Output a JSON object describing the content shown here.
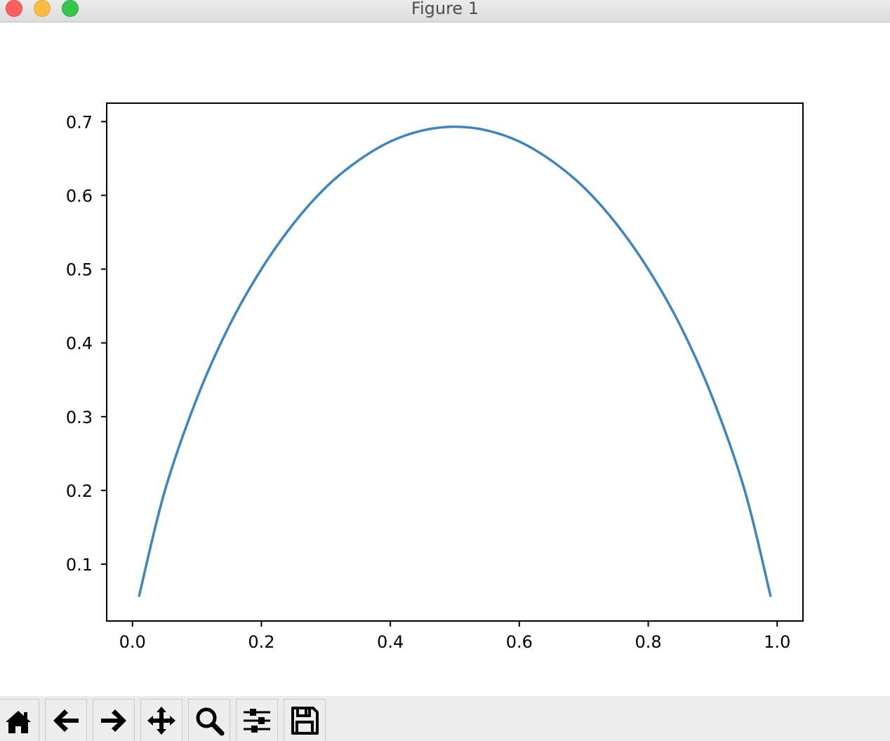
{
  "window": {
    "title": "Figure 1"
  },
  "colors": {
    "line": "#3d85bf",
    "axes": "#000000",
    "close": "#fc605b",
    "minimize": "#fdbc40",
    "maximize": "#34c84a"
  },
  "toolbar": {
    "buttons": [
      {
        "name": "home-button",
        "icon": "home-icon"
      },
      {
        "name": "back-button",
        "icon": "arrow-left-icon"
      },
      {
        "name": "forward-button",
        "icon": "arrow-right-icon"
      },
      {
        "name": "pan-button",
        "icon": "move-icon"
      },
      {
        "name": "zoom-button",
        "icon": "magnifier-icon"
      },
      {
        "name": "configure-subplots-button",
        "icon": "sliders-icon"
      },
      {
        "name": "save-button",
        "icon": "floppy-disk-icon"
      }
    ]
  },
  "chart_data": {
    "type": "line",
    "title": "",
    "xlabel": "",
    "ylabel": "",
    "xlim": [
      -0.04,
      1.04
    ],
    "ylim": [
      0.023,
      0.725
    ],
    "xticks": [
      0.0,
      0.2,
      0.4,
      0.6,
      0.8,
      1.0
    ],
    "xtick_labels": [
      "0.0",
      "0.2",
      "0.4",
      "0.6",
      "0.8",
      "1.0"
    ],
    "yticks": [
      0.1,
      0.2,
      0.3,
      0.4,
      0.5,
      0.6,
      0.7
    ],
    "ytick_labels": [
      "0.1",
      "0.2",
      "0.3",
      "0.4",
      "0.5",
      "0.6",
      "0.7"
    ],
    "grid": false,
    "legend": "none",
    "series": [
      {
        "x": [
          0.01,
          0.05,
          0.1,
          0.15,
          0.2,
          0.25,
          0.3,
          0.35,
          0.4,
          0.45,
          0.5,
          0.55,
          0.6,
          0.65,
          0.7,
          0.75,
          0.8,
          0.85,
          0.9,
          0.95,
          0.99
        ],
        "y": [
          0.056,
          0.199,
          0.325,
          0.423,
          0.5,
          0.562,
          0.611,
          0.647,
          0.673,
          0.688,
          0.693,
          0.688,
          0.673,
          0.647,
          0.611,
          0.562,
          0.5,
          0.423,
          0.325,
          0.199,
          0.056
        ]
      }
    ]
  }
}
